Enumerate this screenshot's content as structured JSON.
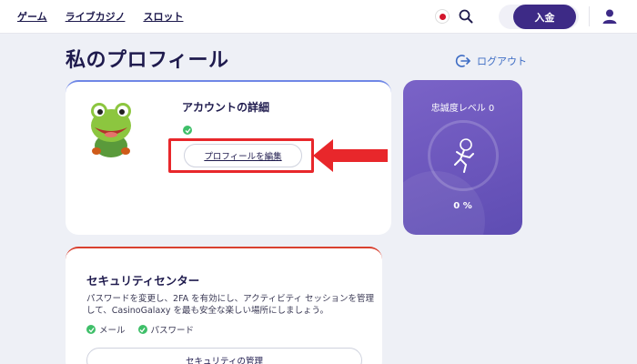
{
  "header": {
    "nav": [
      {
        "label": "ゲーム"
      },
      {
        "label": "ライブカジノ"
      },
      {
        "label": "スロット"
      }
    ],
    "deposit_label": "入金",
    "icons": {
      "flag": "japan-flag-icon",
      "search": "search-icon",
      "user": "user-icon"
    }
  },
  "page": {
    "title": "私のプロフィール",
    "logout_label": "ログアウト"
  },
  "account": {
    "title": "アカウントの詳細",
    "edit_label": "プロフィールを編集"
  },
  "loyalty": {
    "title": "忠誠度レベル 0",
    "percent": "0 %"
  },
  "security": {
    "title": "セキュリティセンター",
    "description": "パスワードを変更し、2FA を有効にし、アクティビティ セッションを管理して、CasinoGalaxy を最も安全な楽しい場所にしましょう。",
    "checks": [
      {
        "label": "メール"
      },
      {
        "label": "パスワード"
      }
    ],
    "manage_label": "セキュリティの管理"
  },
  "colors": {
    "brand": "#3d2a86",
    "highlight": "#e8272b",
    "success": "#3fbf69",
    "loyalty_bg": "#6a55bb",
    "link": "#3d6cc4"
  }
}
